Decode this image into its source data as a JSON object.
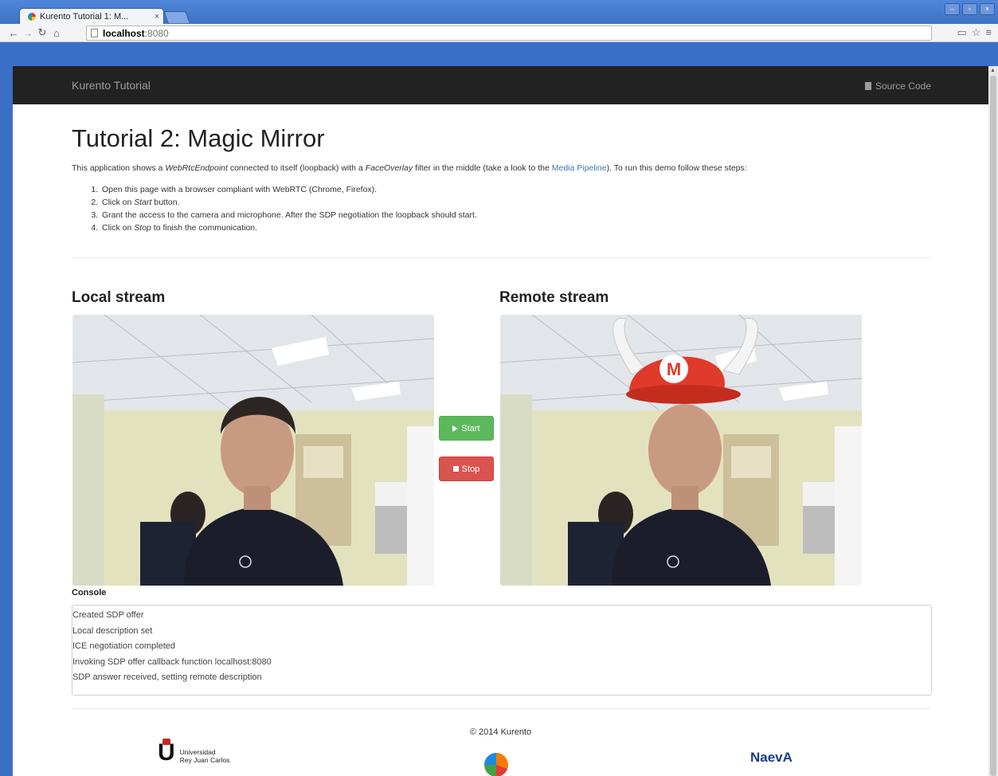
{
  "browser": {
    "tab_title": "Kurento Tutorial 1: M...",
    "tab_close": "×",
    "url_host": "localhost",
    "url_port": ":8080",
    "icons": [
      "back-icon",
      "forward-icon",
      "reload-icon",
      "home-icon",
      "page-icon",
      "cast-icon",
      "star-icon",
      "menu-icon"
    ]
  },
  "navbar": {
    "brand": "Kurento Tutorial",
    "source_code": "Source Code"
  },
  "page": {
    "title": "Tutorial 2: Magic Mirror",
    "intro": {
      "p1": "This application shows a ",
      "em1": "WebRtcEndpoint",
      "p2": " connected to itself (loopback) with a ",
      "em2": "FaceOverlay",
      "p3": " filter in the middle (take a look to the ",
      "link": "Media Pipeline",
      "p4": "). To run this demo follow these steps:"
    },
    "steps": {
      "s1": "Open this page with a browser compliant with WebRTC (Chrome, Firefox).",
      "s2_a": "Click on ",
      "s2_em": "Start",
      "s2_b": " button.",
      "s3": "Grant the access to the camera and microphone. After the SDP negotiation the loopback should start.",
      "s4_a": "Click on ",
      "s4_em": "Stop",
      "s4_b": " to finish the communication."
    },
    "local_stream_label": "Local stream",
    "remote_stream_label": "Remote stream",
    "start_label": "Start",
    "stop_label": "Stop",
    "console_label": "Console",
    "console_lines": [
      "Created SDP offer",
      "Local description set",
      "ICE negotiation completed",
      "Invoking SDP offer callback function localhost:8080",
      "SDP answer received, setting remote description"
    ],
    "footer": {
      "copyright": "© 2014 Kurento",
      "urjc_line1": "Universidad",
      "urjc_line2": "Rey Juan Carlos",
      "naeva": "NaevA"
    }
  },
  "colors": {
    "navbar_bg": "#222222",
    "start_green": "#5cb85c",
    "stop_red": "#d9534f",
    "link_blue": "#337ab7",
    "cap_red": "#e03a2c"
  }
}
